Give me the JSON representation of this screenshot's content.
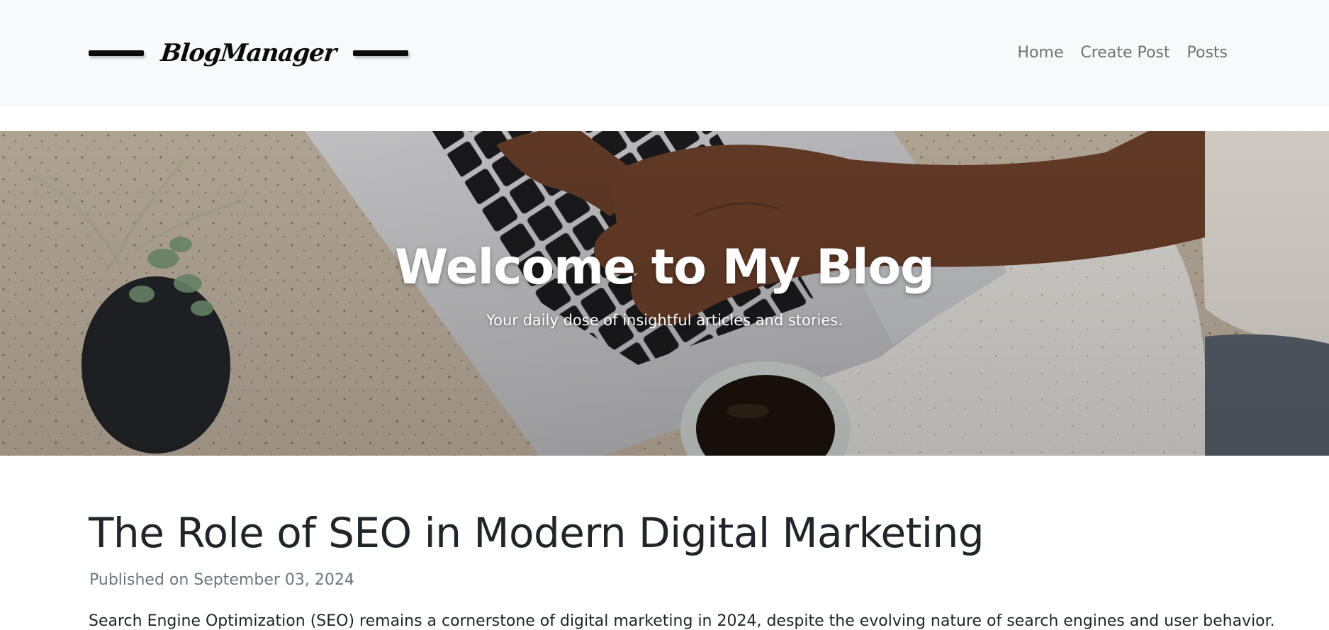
{
  "navbar": {
    "brand": "BlogManager",
    "links": [
      {
        "label": "Home"
      },
      {
        "label": "Create Post"
      },
      {
        "label": "Posts"
      }
    ]
  },
  "hero": {
    "title": "Welcome to My Blog",
    "subtitle": "Your daily dose of insightful articles and stories.",
    "image": "hands typing on laptop keyboard with coffee cup and plant"
  },
  "post": {
    "title": "The Role of SEO in Modern Digital Marketing",
    "meta": "Published on September 03, 2024",
    "excerpt": "Search Engine Optimization (SEO) remains a cornerstone of digital marketing in 2024, despite the evolving nature of search engines and user behavior."
  },
  "colors": {
    "navbar_bg": "#f8f9fa",
    "nav_link": "#6e7174",
    "text_dark": "#212529",
    "text_muted": "#6c757d"
  }
}
